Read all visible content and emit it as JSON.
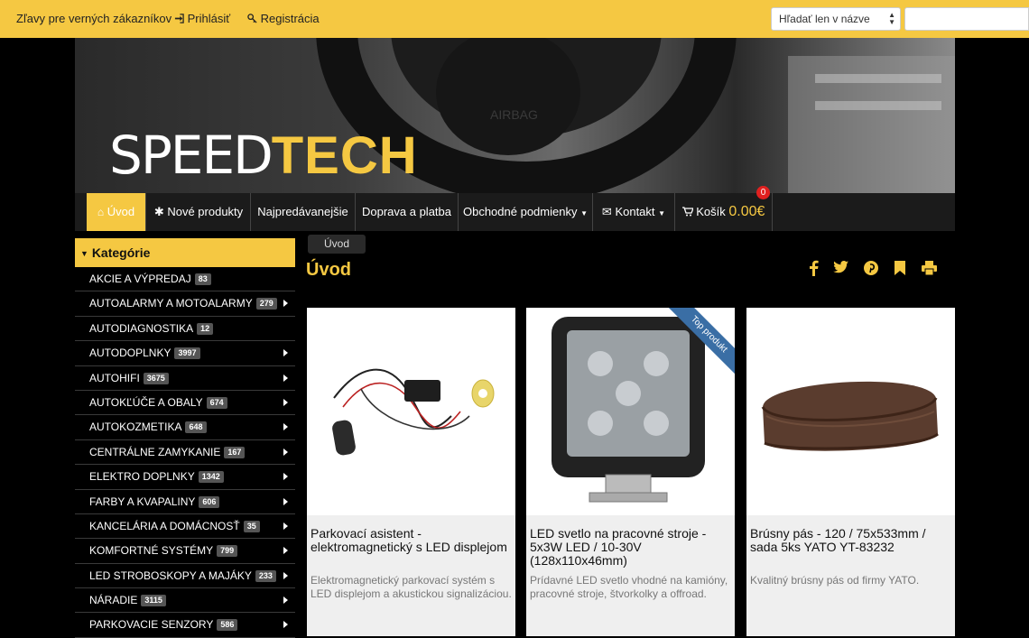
{
  "topbar": {
    "loyalty": "Zľavy pre verných zákazníkov",
    "login": "Prihlásiť",
    "register": "Registrácia",
    "search_select": "Hľadať len v názve",
    "search_value": ""
  },
  "logo": {
    "part1": "SPEED",
    "part2": "TECH"
  },
  "nav": {
    "home": "Úvod",
    "new": "Nové produkty",
    "best": "Najpredávanejšie",
    "shipping": "Doprava a platba",
    "terms": "Obchodné podmienky",
    "contact": "Kontakt",
    "cart": "Košík",
    "cart_price": "0.00€",
    "cart_count": "0"
  },
  "sidebar": {
    "title": "Kategórie",
    "items": [
      {
        "label": "AKCIE A VÝPREDAJ",
        "count": "83",
        "arrow": false
      },
      {
        "label": "AUTOALARMY A MOTOALARMY",
        "count": "279",
        "arrow": true
      },
      {
        "label": "AUTODIAGNOSTIKA",
        "count": "12",
        "arrow": false
      },
      {
        "label": "AUTODOPLNKY",
        "count": "3997",
        "arrow": true
      },
      {
        "label": "AUTOHIFI",
        "count": "3675",
        "arrow": true
      },
      {
        "label": "AUTOKĽÚČE A OBALY",
        "count": "674",
        "arrow": true
      },
      {
        "label": "AUTOKOZMETIKA",
        "count": "648",
        "arrow": true
      },
      {
        "label": "CENTRÁLNE ZAMYKANIE",
        "count": "167",
        "arrow": true
      },
      {
        "label": "ELEKTRO DOPLNKY",
        "count": "1342",
        "arrow": true
      },
      {
        "label": "FARBY A KVAPALINY",
        "count": "606",
        "arrow": true
      },
      {
        "label": "KANCELÁRIA A DOMÁCNOSŤ",
        "count": "35",
        "arrow": true
      },
      {
        "label": "KOMFORTNÉ SYSTÉMY",
        "count": "799",
        "arrow": true
      },
      {
        "label": "LED STROBOSKOPY A MAJÁKY",
        "count": "233",
        "arrow": true
      },
      {
        "label": "NÁRADIE",
        "count": "3115",
        "arrow": true
      },
      {
        "label": "PARKOVACIE SENZORY",
        "count": "586",
        "arrow": true
      }
    ]
  },
  "breadcrumb": "Úvod",
  "page_title": "Úvod",
  "products": [
    {
      "name": "Parkovací asistent - elektromagnetický s LED displejom",
      "desc": "Elektromagnetický parkovací systém s LED displejom a akustickou signalizáciou.",
      "ribbon": ""
    },
    {
      "name": "LED svetlo na pracovné stroje - 5x3W LED / 10-30V (128x110x46mm)",
      "desc": "Prídavné LED svetlo vhodné na kamióny, pracovné stroje, štvorkolky a offroad.",
      "ribbon": "Top produkt"
    },
    {
      "name": "Brúsny pás - 120 / 75x533mm / sada 5ks YATO YT-83232",
      "desc": "Kvalitný brúsny pás od firmy YATO.",
      "ribbon": ""
    }
  ],
  "colors": {
    "accent": "#f5c842",
    "dark": "#1b1b1b",
    "badge": "#e0201f",
    "ribbon": "#3a6ea5"
  }
}
